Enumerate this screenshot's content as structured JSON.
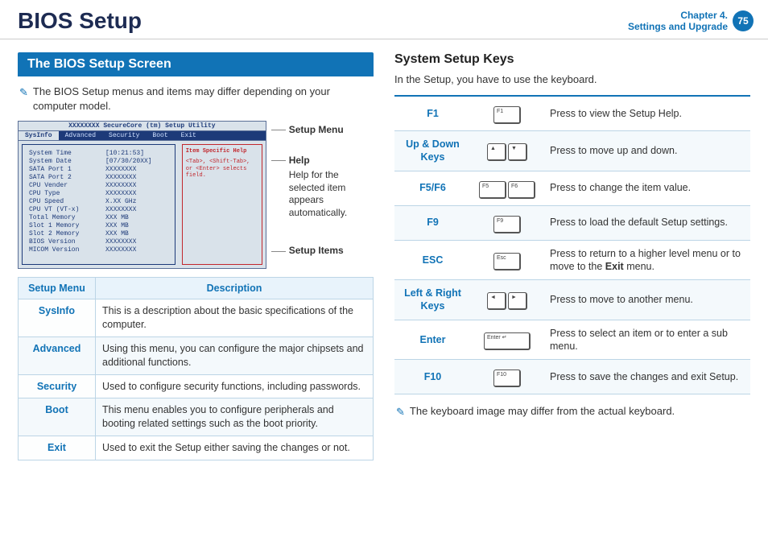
{
  "header": {
    "title": "BIOS Setup",
    "chapter_line1": "Chapter 4.",
    "chapter_line2": "Settings and Upgrade",
    "page_number": "75"
  },
  "left": {
    "section_title": "The BIOS Setup Screen",
    "note": "The BIOS Setup menus and items may differ depending on your computer model.",
    "bios": {
      "title": "XXXXXXXX SecureCore (tm) Setup Utility",
      "tabs": [
        "SysInfo",
        "Advanced",
        "Security",
        "Boot",
        "Exit"
      ],
      "rows": [
        {
          "k": "System Time",
          "v": "[10:21:53]"
        },
        {
          "k": "System Date",
          "v": "[07/30/20XX]"
        },
        {
          "k": "",
          "v": ""
        },
        {
          "k": "SATA Port 1",
          "v": "XXXXXXXX"
        },
        {
          "k": "SATA Port 2",
          "v": "XXXXXXXX"
        },
        {
          "k": "",
          "v": ""
        },
        {
          "k": "CPU Vender",
          "v": "XXXXXXXX"
        },
        {
          "k": "CPU Type",
          "v": "XXXXXXXX"
        },
        {
          "k": "CPU Speed",
          "v": "X.XX GHz"
        },
        {
          "k": "CPU VT (VT-x)",
          "v": "XXXXXXXX"
        },
        {
          "k": "",
          "v": ""
        },
        {
          "k": "Total Memory",
          "v": "XXX MB"
        },
        {
          "k": " Slot 1 Memory",
          "v": "XXX MB"
        },
        {
          "k": " Slot 2 Memory",
          "v": "XXX MB"
        },
        {
          "k": "",
          "v": ""
        },
        {
          "k": "BIOS Version",
          "v": "XXXXXXXX"
        },
        {
          "k": "MICOM Version",
          "v": "XXXXXXXX"
        }
      ],
      "help_title": "Item Specific Help",
      "help_body": "<Tab>, <Shift-Tab>, or <Enter> selects field."
    },
    "callouts": {
      "menu": "Setup Menu",
      "help": "Help",
      "help_sub": "Help for the selected item appears automatically.",
      "items": "Setup Items"
    },
    "menu_table": {
      "head_menu": "Setup Menu",
      "head_desc": "Description",
      "rows": [
        {
          "name": "SysInfo",
          "desc": "This is a description about the basic specifications of the computer."
        },
        {
          "name": "Advanced",
          "desc": "Using this menu, you can configure the major chipsets and additional functions."
        },
        {
          "name": "Security",
          "desc": "Used to configure security functions, including passwords."
        },
        {
          "name": "Boot",
          "desc": "This menu enables you to configure peripherals and booting related settings such as the boot priority."
        },
        {
          "name": "Exit",
          "desc": "Used to exit the Setup either saving the changes or not."
        }
      ]
    }
  },
  "right": {
    "section_title": "System Setup Keys",
    "intro": "In the Setup, you have to use the keyboard.",
    "keys": [
      {
        "name": "F1",
        "caps": [
          "F1"
        ],
        "desc": "Press to view the Setup Help."
      },
      {
        "name": "Up & Down Keys",
        "caps": [
          "▲",
          "▼"
        ],
        "desc": "Press to move up and down."
      },
      {
        "name": "F5/F6",
        "caps": [
          "F5",
          "F6"
        ],
        "desc": "Press to change the item value."
      },
      {
        "name": "F9",
        "caps": [
          "F9"
        ],
        "desc": "Press to load the default Setup settings."
      },
      {
        "name": "ESC",
        "caps": [
          "Esc"
        ],
        "desc_html": "Press to return to a higher level menu or to move to the <b>Exit</b> menu."
      },
      {
        "name": "Left & Right Keys",
        "caps": [
          "◄",
          "►"
        ],
        "desc": "Press to move to another menu."
      },
      {
        "name": "Enter",
        "caps": [
          "Enter ↵"
        ],
        "desc": "Press to select an item or to enter a sub menu."
      },
      {
        "name": "F10",
        "caps": [
          "F10"
        ],
        "desc": "Press to save the changes and exit Setup."
      }
    ],
    "note": "The keyboard image may differ from the actual keyboard."
  }
}
